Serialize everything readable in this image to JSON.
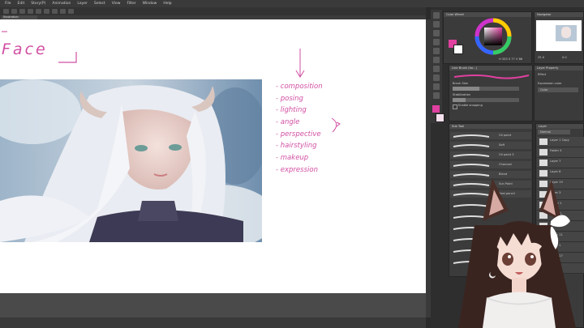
{
  "menubar": {
    "items": [
      "File",
      "Edit",
      "Story(P)",
      "Animation",
      "Layer",
      "Select",
      "View",
      "Filter",
      "Window",
      "Help"
    ]
  },
  "tab": {
    "label": "Illustration (1920x1080)"
  },
  "canvas": {
    "title": "Face",
    "notes": [
      "composition",
      "posing",
      "lighting",
      "angle",
      "perspective",
      "hairstyling",
      "makeup",
      "expression"
    ]
  },
  "color_panel": {
    "title": "Color Wheel",
    "readout": "H 333  S 77  V 86",
    "accent": "#e040a0"
  },
  "navigator": {
    "title": "Navigator",
    "zoom": "25.0",
    "angle": "0.0"
  },
  "brush_panel": {
    "title": "Line Brush (for...)",
    "brush_size_label": "Brush Size",
    "brush_size_value": "",
    "stabilization_label": "Stabilization",
    "stabilization_value": "",
    "snapping_label": "Enable snapping",
    "snapping_value": false
  },
  "effect_panel": {
    "title": "Layer Property",
    "effect_label": "Effect",
    "expression_label": "Expression color",
    "expression_value": "Color"
  },
  "sub_tool": {
    "title": "Sub Tool",
    "items": [
      "Oil paint",
      "Soft",
      "Oil paint 3",
      "Charcoal",
      "Blend",
      "Sun Paint",
      "Real pencil"
    ]
  },
  "layers": {
    "title": "Layer",
    "blend_mode": "Normal",
    "items": [
      {
        "opacity": "100 %",
        "mode": "Normal",
        "name": "Layer 1 Copy"
      },
      {
        "opacity": "100 %",
        "mode": "Normal",
        "name": "Folder 4"
      },
      {
        "opacity": "100 %",
        "mode": "Normal",
        "name": "Layer 7"
      },
      {
        "opacity": "100 %",
        "mode": "Normal",
        "name": "Layer 8"
      },
      {
        "opacity": "100 %",
        "mode": "Normal",
        "name": "Layer 19"
      },
      {
        "opacity": "100 %",
        "mode": "Normal",
        "name": "Layer 3"
      },
      {
        "opacity": "100 %",
        "mode": "Normal",
        "name": "Folder 1"
      },
      {
        "opacity": "100 %",
        "mode": "Normal",
        "name": "Folder 2"
      },
      {
        "opacity": "100 %",
        "mode": "Normal",
        "name": "Layer 6"
      },
      {
        "opacity": "100 %",
        "mode": "Normal",
        "name": "Layer 11"
      },
      {
        "opacity": "100 %",
        "mode": "Normal",
        "name": "Layer 1"
      },
      {
        "opacity": "100 %",
        "mode": "Normal",
        "name": "Layer 17"
      },
      {
        "opacity": "100 %",
        "mode": "Normal",
        "name": "Layer 2"
      }
    ]
  },
  "colors": {
    "canvas_bg": "#ffffff",
    "ink": "#d14fa3",
    "panel": "#3b3b3b",
    "panel_dark": "#2e2e2e"
  }
}
